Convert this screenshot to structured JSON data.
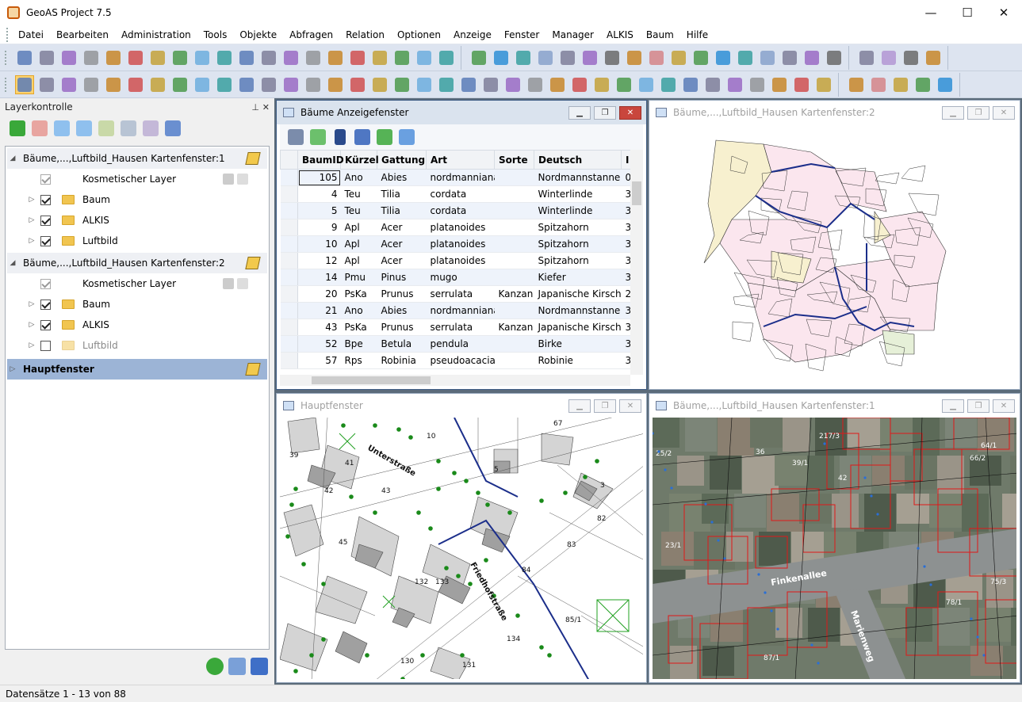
{
  "window": {
    "title": "GeoAS Project 7.5",
    "minimize": "—",
    "maximize": "☐",
    "close": "✕"
  },
  "menu": [
    "Datei",
    "Bearbeiten",
    "Administration",
    "Tools",
    "Objekte",
    "Abfragen",
    "Relation",
    "Optionen",
    "Anzeige",
    "Fenster",
    "Manager",
    "ALKIS",
    "Baum",
    "Hilfe"
  ],
  "toolbar1_icons": [
    "save-icon",
    "print-icon",
    "pdf-icon",
    "cut-icon",
    "copy-icon",
    "paste-icon",
    "undo-icon",
    "table-icon",
    "table-view-icon",
    "map-view-icon",
    "chart-icon",
    "form-icon",
    "layout-icon",
    "map-edit-icon",
    "map-edit2-icon",
    "map-report-icon",
    "map-export-icon",
    "sort-az-icon",
    "plugin-icon",
    "help-icon",
    "line-draw-icon",
    "line-icon",
    "polyline-icon",
    "arc-icon",
    "triangle-icon",
    "circle-icon",
    "rectangle-icon",
    "rounded-rect-icon",
    "text-icon",
    "frame-icon",
    "polygon-icon",
    "polygon-edit-icon",
    "snap-icon",
    "intersect-icon",
    "terrain-icon",
    "label-icon",
    "map-area-icon",
    "back-icon",
    "fit-icon",
    "forward-icon",
    "search-icon"
  ],
  "toolbar2_icons": [
    "select-arrow-icon",
    "select-rect-icon",
    "select-circle-icon",
    "select-poly-icon",
    "select-line-icon",
    "no-select-icon",
    "select-layer-icon",
    "pen-icon",
    "measure-icon",
    "zoom-in-icon",
    "zoom-out-icon",
    "query-icon",
    "pan-icon",
    "hand-select-icon",
    "info-icon",
    "golf-flag-icon",
    "tag-icon",
    "catalog-icon",
    "layers-icon",
    "ruler-icon",
    "crane-icon",
    "list-icon",
    "delete-table-icon",
    "sum-icon",
    "stamp-icon",
    "save-map-icon",
    "house-icon",
    "house-select-icon",
    "scale-icon",
    "legend-icon",
    "filter-icon",
    "save-as-icon",
    "excel-icon",
    "wave-icon",
    "disk-icon",
    "refresh-icon",
    "building-icon",
    "folder-add-icon",
    "folder-delete-icon",
    "folder-open-icon",
    "folder-edit-icon",
    "settings-icon"
  ],
  "layer_panel": {
    "title": "Layerkontrolle",
    "pin": "📌",
    "close": "✕",
    "tree": [
      {
        "level": 0,
        "type": "group",
        "label": "Bäume,...,Luftbild_Hausen Kartenfenster:1"
      },
      {
        "level": 1,
        "type": "cosmetic",
        "label": "Kosmetischer Layer",
        "checked": true
      },
      {
        "level": 1,
        "type": "layer",
        "label": "Baum",
        "checked": true
      },
      {
        "level": 1,
        "type": "layer",
        "label": "ALKIS",
        "checked": true
      },
      {
        "level": 1,
        "type": "layer",
        "label": "Luftbild",
        "checked": true
      },
      {
        "level": 0,
        "type": "group",
        "label": "Bäume,...,Luftbild_Hausen Kartenfenster:2"
      },
      {
        "level": 1,
        "type": "cosmetic",
        "label": "Kosmetischer Layer",
        "checked": true
      },
      {
        "level": 1,
        "type": "layer",
        "label": "Baum",
        "checked": true
      },
      {
        "level": 1,
        "type": "layer",
        "label": "ALKIS",
        "checked": true
      },
      {
        "level": 1,
        "type": "layer",
        "label": "Luftbild",
        "checked": false
      },
      {
        "level": 0,
        "type": "groupsel",
        "label": "Hauptfenster"
      }
    ]
  },
  "table_window": {
    "title": "Bäume Anzeigefenster",
    "columns": [
      "BaumID",
      "Kürzel",
      "Gattung",
      "Art",
      "Sorte",
      "Deutsch",
      "I"
    ],
    "rows": [
      [
        "105",
        "Ano",
        "Abies",
        "nordmanniana",
        "",
        "Nordmannstanne",
        "0"
      ],
      [
        "4",
        "Teu",
        "Tilia",
        "cordata",
        "",
        "Winterlinde",
        "3"
      ],
      [
        "5",
        "Teu",
        "Tilia",
        "cordata",
        "",
        "Winterlinde",
        "3"
      ],
      [
        "9",
        "Apl",
        "Acer",
        "platanoides",
        "",
        "Spitzahorn",
        "3"
      ],
      [
        "10",
        "Apl",
        "Acer",
        "platanoides",
        "",
        "Spitzahorn",
        "3"
      ],
      [
        "12",
        "Apl",
        "Acer",
        "platanoides",
        "",
        "Spitzahorn",
        "3"
      ],
      [
        "14",
        "Pmu",
        "Pinus",
        "mugo",
        "",
        "Kiefer",
        "3"
      ],
      [
        "20",
        "PsKa",
        "Prunus",
        "serrulata",
        "Kanzan",
        "Japanische Kirsche",
        "2"
      ],
      [
        "21",
        "Ano",
        "Abies",
        "nordmanniana",
        "",
        "Nordmannstanne",
        "3"
      ],
      [
        "43",
        "PsKa",
        "Prunus",
        "serrulata",
        "Kanzan",
        "Japanische Kirsche",
        "3"
      ],
      [
        "52",
        "Bpe",
        "Betula",
        "pendula",
        "",
        "Birke",
        "3"
      ],
      [
        "57",
        "Rps",
        "Robinia",
        "pseudoacacia",
        "",
        "Robinie",
        "3"
      ]
    ]
  },
  "map_window_2": {
    "title": "Bäume,...,Luftbild_Hausen Kartenfenster:2"
  },
  "main_window": {
    "title": "Hauptfenster",
    "labels": [
      "Unterstraße",
      "Friedhofstraße",
      "10",
      "39",
      "41",
      "42",
      "43",
      "45",
      "132",
      "133",
      "134",
      "130",
      "131",
      "82",
      "83",
      "84",
      "85/1",
      "67",
      "3",
      "5"
    ]
  },
  "map_window_1": {
    "title": "Bäume,...,Luftbild_Hausen Kartenfenster:1",
    "labels": [
      "Finkenallee",
      "Marienweg",
      "25/2",
      "217/3",
      "39/1",
      "42",
      "66/2",
      "64/1",
      "36",
      "23/1",
      "75/3",
      "78/1",
      "87/1"
    ]
  },
  "status": {
    "records": "Datensätze 1 - 13 von 88"
  },
  "colors": {
    "accent": "#9cb4d6",
    "toolbar": "#dde4f0",
    "mdi_bg": "#5b6b7a",
    "tree_green": "#1a8a1a"
  }
}
